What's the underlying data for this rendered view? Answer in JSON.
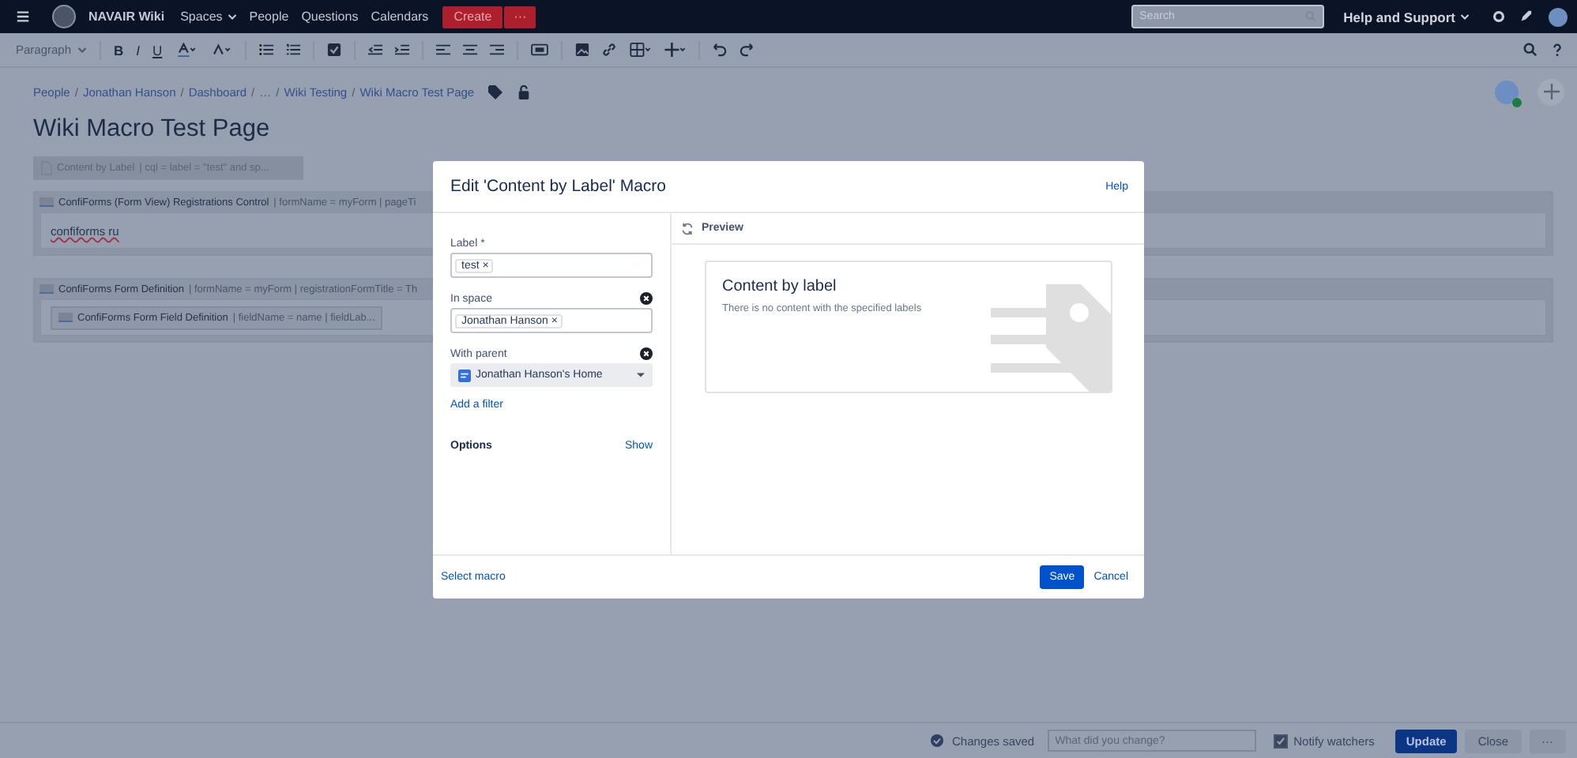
{
  "top_nav": {
    "site_name": "NAVAIR Wiki",
    "links": [
      {
        "label": "Spaces",
        "dropdown": true
      },
      {
        "label": "People",
        "dropdown": false
      },
      {
        "label": "Questions",
        "dropdown": false
      },
      {
        "label": "Calendars",
        "dropdown": false
      }
    ],
    "create_button": "Create",
    "more_button": "···",
    "search": {
      "placeholder": "Search"
    },
    "help_menu": "Help and Support"
  },
  "editor_toolbar": {
    "paragraph_style": "Paragraph",
    "format_buttons": [
      "B",
      "I",
      "U"
    ]
  },
  "breadcrumbs": [
    {
      "label": "People"
    },
    {
      "separator": "/",
      "label": "Jonathan Hanson"
    },
    {
      "separator": "/",
      "label": "Dashboard"
    },
    {
      "separator": "/",
      "label": "…"
    },
    {
      "separator": "/",
      "label": "Wiki Testing"
    },
    {
      "separator": "/",
      "label": "Wiki Macro Test Page"
    }
  ],
  "page_title": "Wiki Macro Test Page",
  "macros": [
    {
      "kind": "inline",
      "name": "Content by Label",
      "params": "| cql = label = \"test\" and sp..."
    },
    {
      "kind": "block",
      "name": "ConfiForms (Form View) Registrations Control",
      "params": "| formName = myForm | pageTi",
      "body_text": "confiforms ru"
    },
    {
      "kind": "block",
      "name": "ConfiForms Form Definition",
      "params": "| formName = myForm | registrationFormTitle = Th",
      "nested": {
        "name": "ConfiForms Form Field Definition",
        "params": "| fieldName = name | fieldLab..."
      }
    }
  ],
  "dialog": {
    "title": "Edit 'Content by Label' Macro",
    "help_link": "Help",
    "fields": [
      {
        "kind": "tags",
        "label": "Label *",
        "tags": [
          {
            "text": "test",
            "remove": "×"
          }
        ],
        "clearable": false
      },
      {
        "kind": "tags",
        "label": "In space",
        "tags": [
          {
            "text": "Jonathan Hanson",
            "remove": "×"
          }
        ],
        "clearable": true
      },
      {
        "kind": "select",
        "label": "With parent",
        "value": "Jonathan Hanson's Home",
        "clearable": true
      }
    ],
    "add_filter_link": "Add a filter",
    "options_label": "Options",
    "options_toggle": "Show",
    "preview": {
      "header": "Preview",
      "card_title": "Content by label",
      "message": "There is no content with the specified labels"
    },
    "select_macro_link": "Select macro",
    "save_button": "Save",
    "cancel_button": "Cancel"
  },
  "footer": {
    "status": "Changes saved",
    "comment": {
      "placeholder": "What did you change?"
    },
    "notify": {
      "label": "Notify watchers",
      "checked": true
    },
    "update_button": "Update",
    "close_button": "Close",
    "more_button": "···"
  }
}
